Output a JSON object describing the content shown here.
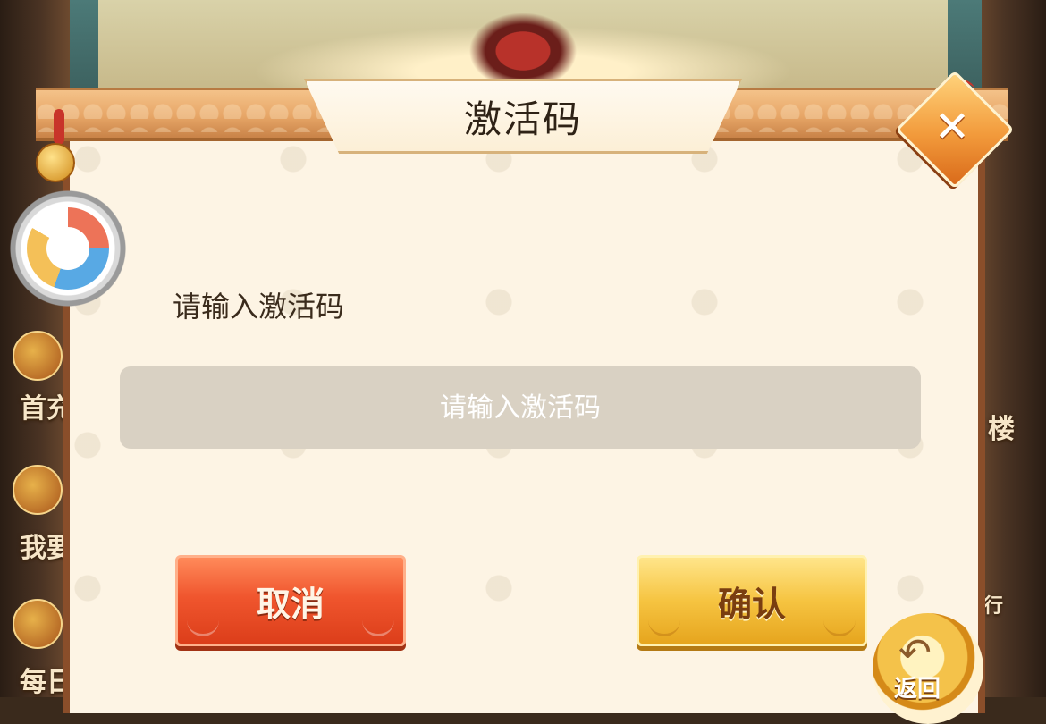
{
  "dialog": {
    "title": "激活码",
    "prompt_label": "请输入激活码",
    "input": {
      "value": "",
      "placeholder": "请输入激活码"
    },
    "buttons": {
      "cancel_label": "取消",
      "confirm_label": "确认"
    },
    "close_icon": "close-icon",
    "close_glyph": "✕"
  },
  "background": {
    "side_labels": {
      "left_top": "首充",
      "left_mid": "我要",
      "left_bottom": "每日",
      "right_mid": "楼",
      "right_bottom": "行"
    },
    "back_button_label": "返回",
    "back_icon": "undo-arrow-icon",
    "back_glyph": "↶"
  },
  "colors": {
    "cancel": "#f0562e",
    "confirm": "#f6c441",
    "panel": "#fdf4e4",
    "frame": "#8a4e2a"
  }
}
